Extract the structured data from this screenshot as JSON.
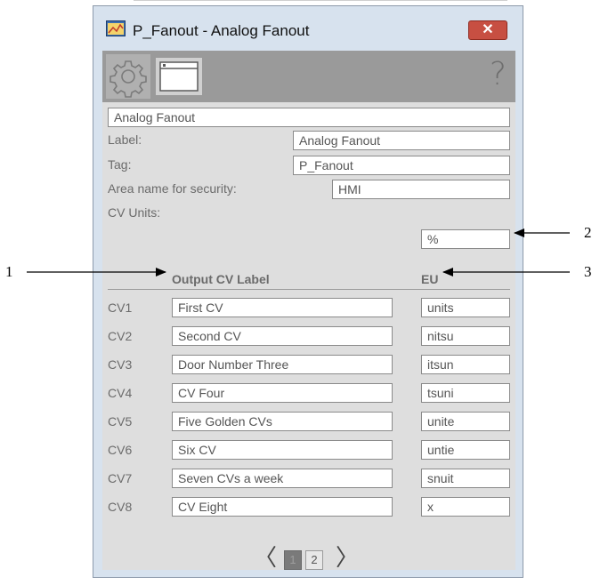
{
  "window": {
    "title": "P_Fanout - Analog Fanout",
    "close_symbol": "✕"
  },
  "toolbar": {
    "icons": [
      "gear-icon",
      "window-icon",
      "help-icon"
    ],
    "help_symbol": "?"
  },
  "config": {
    "description": "Analog Fanout",
    "label_caption": "Label:",
    "label_value": "Analog Fanout",
    "tag_caption": "Tag:",
    "tag_value": "P_Fanout",
    "area_caption": "Area name for security:",
    "area_value": "HMI",
    "cv_units_caption": "CV Units:",
    "cv_units_value": "%"
  },
  "table": {
    "col_label": "Output CV Label",
    "col_eu": "EU",
    "rows": [
      {
        "cv": "CV1",
        "label": "First CV",
        "eu": "units"
      },
      {
        "cv": "CV2",
        "label": "Second CV",
        "eu": "nitsu"
      },
      {
        "cv": "CV3",
        "label": "Door Number Three",
        "eu": "itsun"
      },
      {
        "cv": "CV4",
        "label": "CV Four",
        "eu": "tsuni"
      },
      {
        "cv": "CV5",
        "label": "Five Golden CVs",
        "eu": "unite"
      },
      {
        "cv": "CV6",
        "label": "Six CV",
        "eu": "untie"
      },
      {
        "cv": "CV7",
        "label": "Seven CVs a week",
        "eu": "snuit"
      },
      {
        "cv": "CV8",
        "label": "CV Eight",
        "eu": "x"
      }
    ]
  },
  "pager": {
    "prev": "〈",
    "next": "〉",
    "pages": [
      "1",
      "2"
    ],
    "current": "1"
  },
  "callouts": {
    "c1": "1",
    "c2": "2",
    "c3": "3"
  },
  "colors": {
    "window_bg": "#d7e2ee",
    "panel_bg": "#dedede",
    "toolbar_bg": "#9a9a9a",
    "close_button": "#c74f42",
    "active_page": "#7a7a7a"
  }
}
